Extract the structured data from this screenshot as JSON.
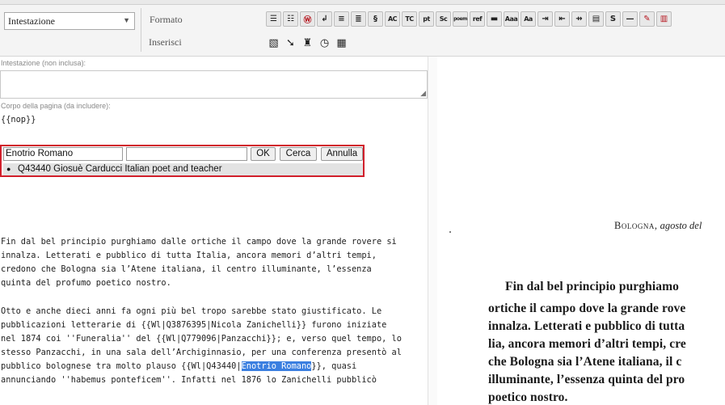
{
  "toolbar": {
    "style_select": "Intestazione",
    "formato_label": "Formato",
    "inserisci_label": "Inserisci",
    "format_buttons": [
      {
        "icon": "bulleted-list-icon",
        "glyph": "☰"
      },
      {
        "icon": "numbered-list-icon",
        "glyph": "☷"
      },
      {
        "icon": "wikipedia-icon",
        "glyph": "Ⓦ"
      },
      {
        "icon": "return-arrow-icon",
        "glyph": "↲"
      },
      {
        "icon": "align-center-icon",
        "glyph": "≡"
      },
      {
        "icon": "align-right-icon",
        "glyph": "≣"
      },
      {
        "icon": "section-icon",
        "glyph": "§"
      },
      {
        "icon": "ac-icon",
        "glyph": "AC"
      },
      {
        "icon": "tc-icon",
        "glyph": "TC"
      },
      {
        "icon": "pt-icon",
        "glyph": "pt"
      },
      {
        "icon": "sc-icon",
        "glyph": "Sc"
      },
      {
        "icon": "poem-icon",
        "glyph": "poem"
      },
      {
        "icon": "ref-icon",
        "glyph": "ref"
      },
      {
        "icon": "horizontal-line-icon",
        "glyph": "▬"
      },
      {
        "icon": "font-size-icon",
        "glyph": "Aaa"
      },
      {
        "icon": "spellcheck-icon",
        "glyph": "Aa"
      },
      {
        "icon": "indent-icon",
        "glyph": "⇥"
      },
      {
        "icon": "outdent-icon",
        "glyph": "⇤"
      },
      {
        "icon": "right-tab-icon",
        "glyph": "⇸"
      },
      {
        "icon": "justify-icon",
        "glyph": "▤"
      },
      {
        "icon": "strike-s-icon",
        "glyph": "S"
      },
      {
        "icon": "em-dash-icon",
        "glyph": "—"
      },
      {
        "icon": "pin-icon",
        "glyph": "✎"
      },
      {
        "icon": "bars-chart-icon",
        "glyph": "▥"
      }
    ],
    "insert_buttons": [
      {
        "icon": "image-icon",
        "glyph": "▧"
      },
      {
        "icon": "arrow-insert-icon",
        "glyph": "➘"
      },
      {
        "icon": "portrait-icon",
        "glyph": "♜"
      },
      {
        "icon": "clock-icon",
        "glyph": "◷"
      },
      {
        "icon": "table-icon",
        "glyph": "▦"
      }
    ]
  },
  "editor": {
    "header_label": "Intestazione (non inclusa):",
    "body_label": "Corpo della pagina (da includere):",
    "nop_line": "{{nop}}",
    "para1": "Fin dal bel principio purghiamo dalle ortiche il campo dove la grande rovere si\ninnalza. Letterati e pubblico di tutta Italia, ancora memori d’altri tempi,\ncredono che Bologna sia l’Atene italiana, il centro illuminante, l’essenza\nquinta del profumo poetico nostro.",
    "para2_before": "Otto e anche dieci anni fa ogni più bel tropo sarebbe stato giustificato. Le\npubblicazioni letterarie di {{Wl|Q3876395|Nicola Zanichelli}} furono iniziate\nnel 1874 coi ''Funeralia'' del {{Wl|Q779096|Panzacchi}}; e, verso quel tempo, lo\nstesso Panzacchi, in una sala dell’Archiginnasio, per una conferenza presentò al\npubblico bolognese tra molto plauso {{Wl|Q43440|",
    "para2_selected": "Enotrio Romano",
    "para2_after": "}}, quasi\nannunciando ''habemus ponteficem''. Infatti nel 1876 lo Zanichelli pubblicò"
  },
  "lookup": {
    "name_value": "Enotrio Romano",
    "query_value": "",
    "ok_label": "OK",
    "cerca_label": "Cerca",
    "annulla_label": "Annulla",
    "suggestion": "Q43440 Giosuè Carducci Italian poet and teacher",
    "border_color": "#d11f2b"
  },
  "scan": {
    "heading_place": "Bologna,",
    "heading_date": "agosto del",
    "lines": [
      "Fin dal bel principio purghiamo",
      "ortiche il campo dove la grande rove",
      "innalza. Letterati e pubblico di tutta",
      "lia, ancora memori d’altri tempi, cre",
      "che Bologna sia l’Atene italiana, il c",
      "illuminante, l’essenza quinta del pro",
      "poetico nostro."
    ]
  }
}
